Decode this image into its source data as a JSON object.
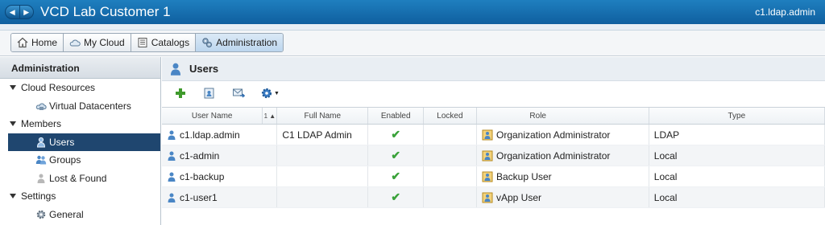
{
  "app": {
    "title": "VCD Lab Customer 1",
    "current_user": "c1.ldap.admin"
  },
  "tabs": [
    {
      "label": "Home",
      "icon": "home-icon"
    },
    {
      "label": "My Cloud",
      "icon": "cloud-icon"
    },
    {
      "label": "Catalogs",
      "icon": "catalog-icon"
    },
    {
      "label": "Administration",
      "icon": "admin-gears-icon",
      "active": true
    }
  ],
  "left": {
    "header": "Administration",
    "groups": [
      {
        "label": "Cloud Resources",
        "items": [
          {
            "label": "Virtual Datacenters",
            "icon": "vdc-icon"
          }
        ]
      },
      {
        "label": "Members",
        "items": [
          {
            "label": "Users",
            "icon": "user-icon",
            "selected": true
          },
          {
            "label": "Groups",
            "icon": "group-icon"
          },
          {
            "label": "Lost & Found",
            "icon": "lost-found-icon"
          }
        ]
      },
      {
        "label": "Settings",
        "items": [
          {
            "label": "General",
            "icon": "gear-icon"
          }
        ]
      }
    ]
  },
  "main": {
    "title": "Users",
    "toolbar": [
      "add-icon",
      "import-users-icon",
      "send-message-icon",
      "actions-gear-icon"
    ],
    "columns": {
      "user_name": "User Name",
      "sort": "1 ▲",
      "full_name": "Full Name",
      "enabled": "Enabled",
      "locked": "Locked",
      "role": "Role",
      "type": "Type"
    },
    "rows": [
      {
        "user_name": "c1.ldap.admin",
        "full_name": "C1 LDAP Admin",
        "enabled": true,
        "role": "Organization Administrator",
        "type": "LDAP"
      },
      {
        "user_name": "c1-admin",
        "full_name": "",
        "enabled": true,
        "role": "Organization Administrator",
        "type": "Local"
      },
      {
        "user_name": "c1-backup",
        "full_name": "",
        "enabled": true,
        "role": "Backup User",
        "type": "Local"
      },
      {
        "user_name": "c1-user1",
        "full_name": "",
        "enabled": true,
        "role": "vApp User",
        "type": "Local"
      }
    ]
  },
  "colors": {
    "titlebar": "#1f7fbf",
    "selected": "#1f466f",
    "check": "#3aa23a"
  }
}
